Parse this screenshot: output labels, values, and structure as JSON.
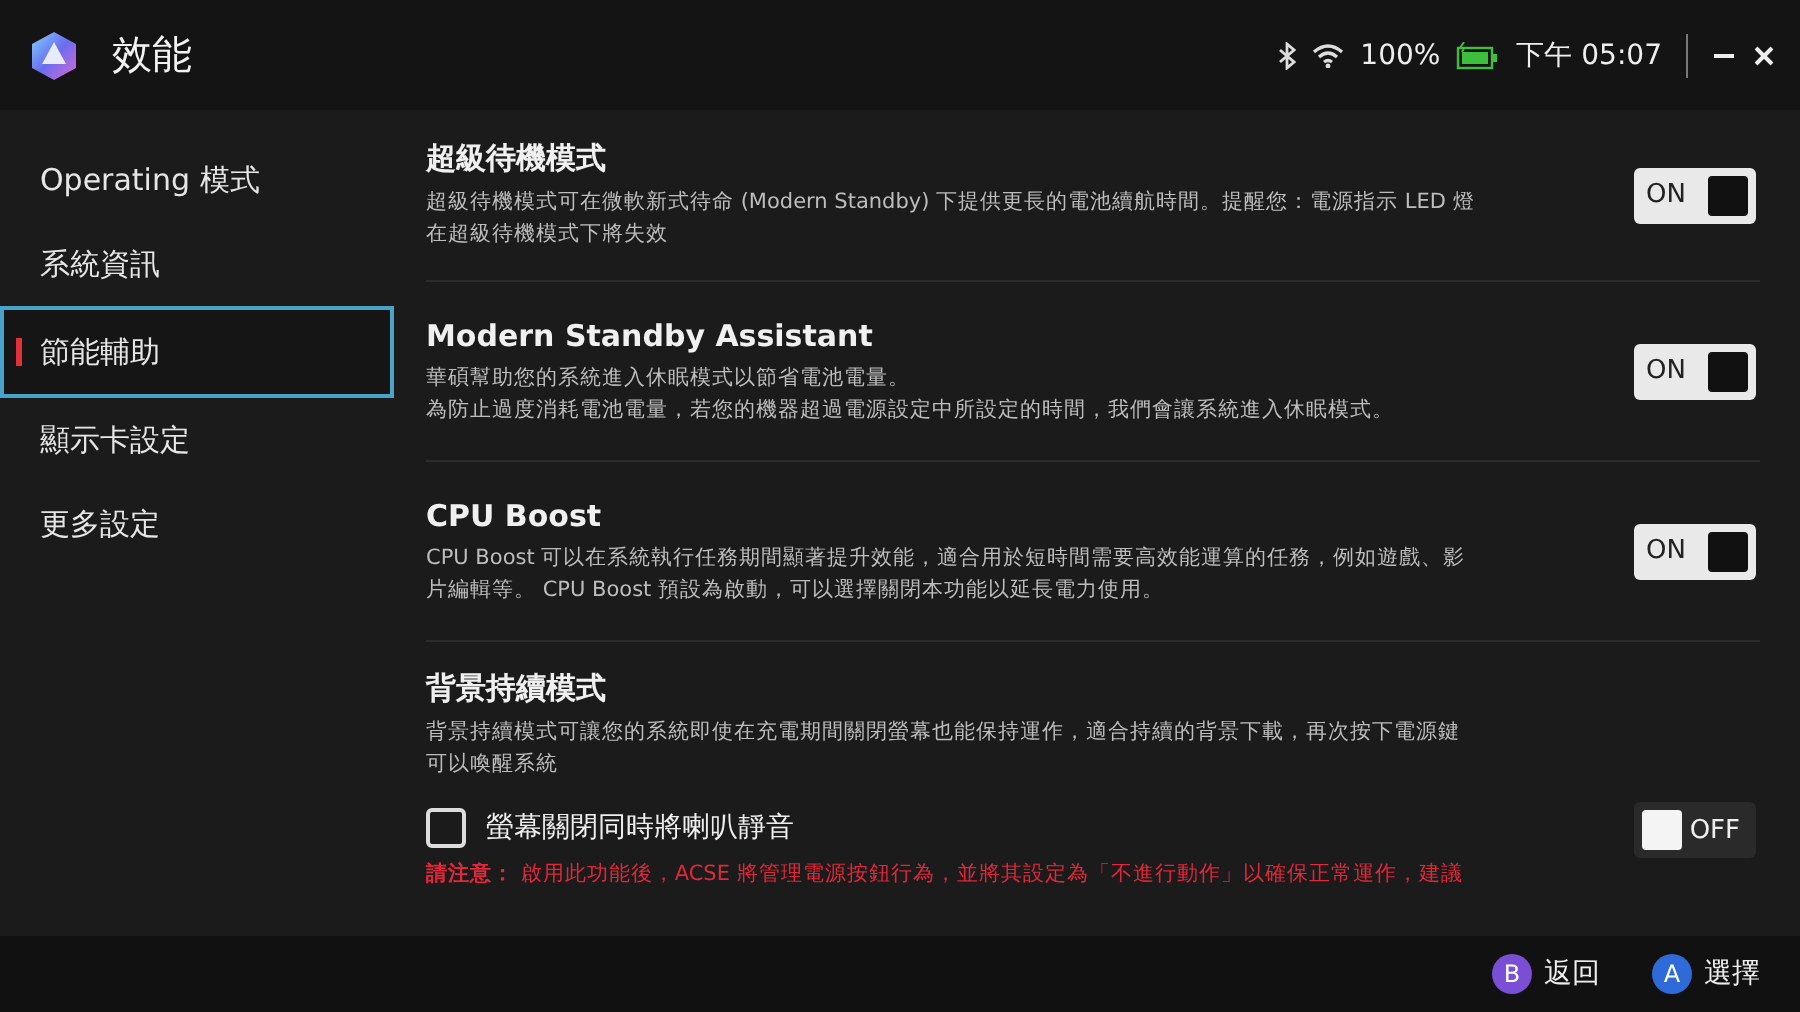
{
  "window": {
    "title": "效能"
  },
  "status": {
    "battery": "100%",
    "time": "下午 05:07"
  },
  "sidebar": {
    "items": [
      {
        "label": "Operating 模式",
        "selected": false
      },
      {
        "label": "系統資訊",
        "selected": false
      },
      {
        "label": "節能輔助",
        "selected": true
      },
      {
        "label": "顯示卡設定",
        "selected": false
      },
      {
        "label": "更多設定",
        "selected": false
      }
    ]
  },
  "sections": [
    {
      "title": "超級待機模式",
      "description_lines": [
        "超級待機模式可在微軟新式待命 (Modern Standby) 下提供更長的電池續航時間。提醒您：電源指示 LED 燈",
        "在超級待機模式下將失效"
      ],
      "toggle": {
        "on": true,
        "label": "ON"
      }
    },
    {
      "title": "Modern Standby Assistant",
      "description_lines": [
        "華碩幫助您的系統進入休眠模式以節省電池電量。",
        "為防止過度消耗電池電量，若您的機器超過電源設定中所設定的時間，我們會讓系統進入休眠模式。"
      ],
      "toggle": {
        "on": true,
        "label": "ON"
      }
    },
    {
      "title": "CPU Boost",
      "description_lines": [
        "CPU Boost 可以在系統執行任務期間顯著提升效能，適合用於短時間需要高效能運算的任務，例如遊戲、影",
        "片編輯等。 CPU Boost 預設為啟動，可以選擇關閉本功能以延長電力使用。"
      ],
      "toggle": {
        "on": true,
        "label": "ON"
      }
    },
    {
      "title": "背景持續模式",
      "description_lines": [
        "背景持續模式可讓您的系統即使在充電期間關閉螢幕也能保持運作，適合持續的背景下載，再次按下電源鍵",
        "可以喚醒系統"
      ],
      "toggle": {
        "on": false,
        "label": "OFF"
      },
      "checkbox": {
        "label": "螢幕關閉同時將喇叭靜音",
        "checked": false
      },
      "note": "**請注意：** 啟用此功能後，ACSE 將管理電源按鈕行為，並將其設定為「不進行動作」以確保正常運作，建議"
    }
  ],
  "footer": {
    "buttons": [
      {
        "key": "B",
        "label": "返回",
        "color": "#7a4fd6"
      },
      {
        "key": "A",
        "label": "選擇",
        "color": "#2e6bd9"
      }
    ]
  }
}
